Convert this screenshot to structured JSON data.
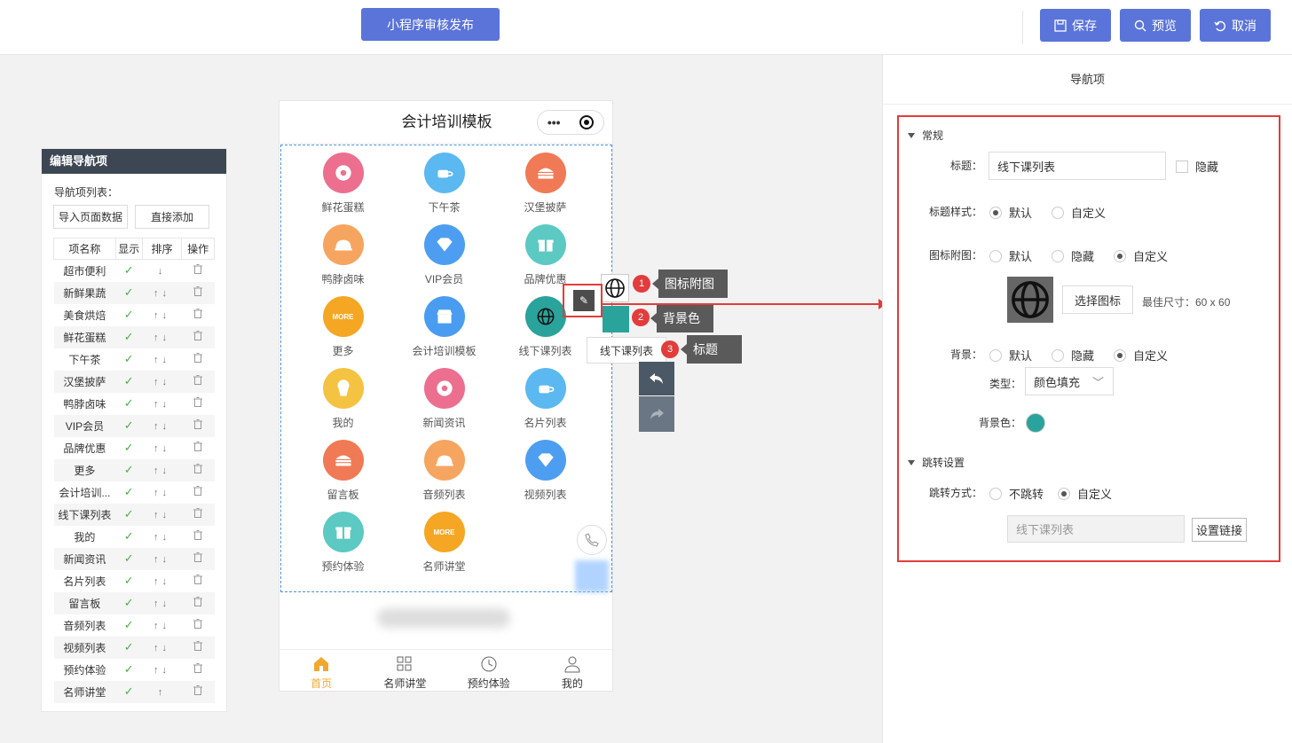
{
  "topbar": {
    "publish_label": "小程序审核发布",
    "save_label": "保存",
    "preview_label": "预览",
    "cancel_label": "取消"
  },
  "left_panel": {
    "title": "编辑导航项",
    "list_label": "导航项列表：",
    "import_button": "导入页面数据",
    "add_button": "直接添加",
    "columns": [
      "项名称",
      "显示",
      "排序",
      "操作"
    ],
    "check_glyph": "✓",
    "rows": [
      {
        "name": "超市便利",
        "sort": "↓"
      },
      {
        "name": "新鲜果蔬",
        "sort": "↑↓"
      },
      {
        "name": "美食烘焙",
        "sort": "↑↓"
      },
      {
        "name": "鲜花蛋糕",
        "sort": "↑↓"
      },
      {
        "name": "下午茶",
        "sort": "↑↓"
      },
      {
        "name": "汉堡披萨",
        "sort": "↑↓"
      },
      {
        "name": "鸭脖卤味",
        "sort": "↑↓"
      },
      {
        "name": "VIP会员",
        "sort": "↑↓"
      },
      {
        "name": "品牌优惠",
        "sort": "↑↓"
      },
      {
        "name": "更多",
        "sort": "↑↓"
      },
      {
        "name": "会计培训...",
        "sort": "↑↓"
      },
      {
        "name": "线下课列表",
        "sort": "↑↓"
      },
      {
        "name": "我的",
        "sort": "↑↓"
      },
      {
        "name": "新闻资讯",
        "sort": "↑↓"
      },
      {
        "name": "名片列表",
        "sort": "↑↓"
      },
      {
        "name": "留言板",
        "sort": "↑↓"
      },
      {
        "name": "音频列表",
        "sort": "↑↓"
      },
      {
        "name": "视频列表",
        "sort": "↑↓"
      },
      {
        "name": "预约体验",
        "sort": "↑↓"
      },
      {
        "name": "名师讲堂",
        "sort": "↑"
      }
    ]
  },
  "phone": {
    "title": "会计培训模板",
    "capsule_dots": "•••",
    "grid": [
      {
        "label": "鲜花蛋糕",
        "color": "#ec6f8f",
        "icon": "donut-icon"
      },
      {
        "label": "下午茶",
        "color": "#5bb8f0",
        "icon": "coffee-icon"
      },
      {
        "label": "汉堡披萨",
        "color": "#f07a55",
        "icon": "burger-icon"
      },
      {
        "label": "鸭脖卤味",
        "color": "#f6a560",
        "icon": "cloche-icon"
      },
      {
        "label": "VIP会员",
        "color": "#4d9ef0",
        "icon": "diamond-icon"
      },
      {
        "label": "品牌优惠",
        "color": "#5cc9c3",
        "icon": "gift-icon"
      },
      {
        "label": "更多",
        "color": "#f5a623",
        "icon": "more-icon",
        "text": "MORE"
      },
      {
        "label": "会计培训模板",
        "color": "#4a9cf0",
        "icon": "shop-icon"
      },
      {
        "label": "线下课列表",
        "color": "#29a39b",
        "icon": "globe-icon"
      },
      {
        "label": "我的",
        "color": "#f5c342",
        "icon": "muffin-icon"
      },
      {
        "label": "新闻资讯",
        "color": "#ec6f8f",
        "icon": "donut-icon"
      },
      {
        "label": "名片列表",
        "color": "#5bb8f0",
        "icon": "coffee-icon"
      },
      {
        "label": "留言板",
        "color": "#f07a55",
        "icon": "burger-icon"
      },
      {
        "label": "音频列表",
        "color": "#f6a560",
        "icon": "cloche-icon"
      },
      {
        "label": "视频列表",
        "color": "#4d9ef0",
        "icon": "diamond-icon"
      },
      {
        "label": "预约体验",
        "color": "#5cc9c3",
        "icon": "gift-icon"
      },
      {
        "label": "名师讲堂",
        "color": "#f5a623",
        "icon": "more-icon",
        "text": "MORE"
      }
    ],
    "tabs": [
      {
        "label": "首页",
        "icon": "home-icon",
        "active": true
      },
      {
        "label": "名师讲堂",
        "icon": "grid-icon",
        "active": false
      },
      {
        "label": "预约体验",
        "icon": "clock-icon",
        "active": false
      },
      {
        "label": "我的",
        "icon": "user-icon",
        "active": false
      }
    ]
  },
  "editor": {
    "tooltip_text": "线下课列表",
    "callouts": [
      {
        "num": "1",
        "label": "图标附图"
      },
      {
        "num": "2",
        "label": "背景色"
      },
      {
        "num": "3",
        "label": "标题"
      }
    ]
  },
  "right_panel": {
    "title": "导航项",
    "section_general": "常规",
    "title_label": "标题：",
    "title_value": "线下课列表",
    "hide_label": "隐藏",
    "title_style_label": "标题样式：",
    "title_style_options": [
      "默认",
      "自定义"
    ],
    "icon_label": "图标附图：",
    "icon_options": [
      "默认",
      "隐藏",
      "自定义"
    ],
    "choose_icon_button": "选择图标",
    "icon_size_hint": "最佳尺寸：60 x 60",
    "bg_label": "背景：",
    "bg_options": [
      "默认",
      "隐藏",
      "自定义"
    ],
    "type_label": "类型：",
    "type_value": "颜色填充",
    "bg_color_label": "背景色：",
    "bg_color": "#29a39b",
    "section_jump": "跳转设置",
    "jump_label": "跳转方式：",
    "jump_options": [
      "不跳转",
      "自定义"
    ],
    "link_value": "线下课列表",
    "set_link_button": "设置链接"
  }
}
